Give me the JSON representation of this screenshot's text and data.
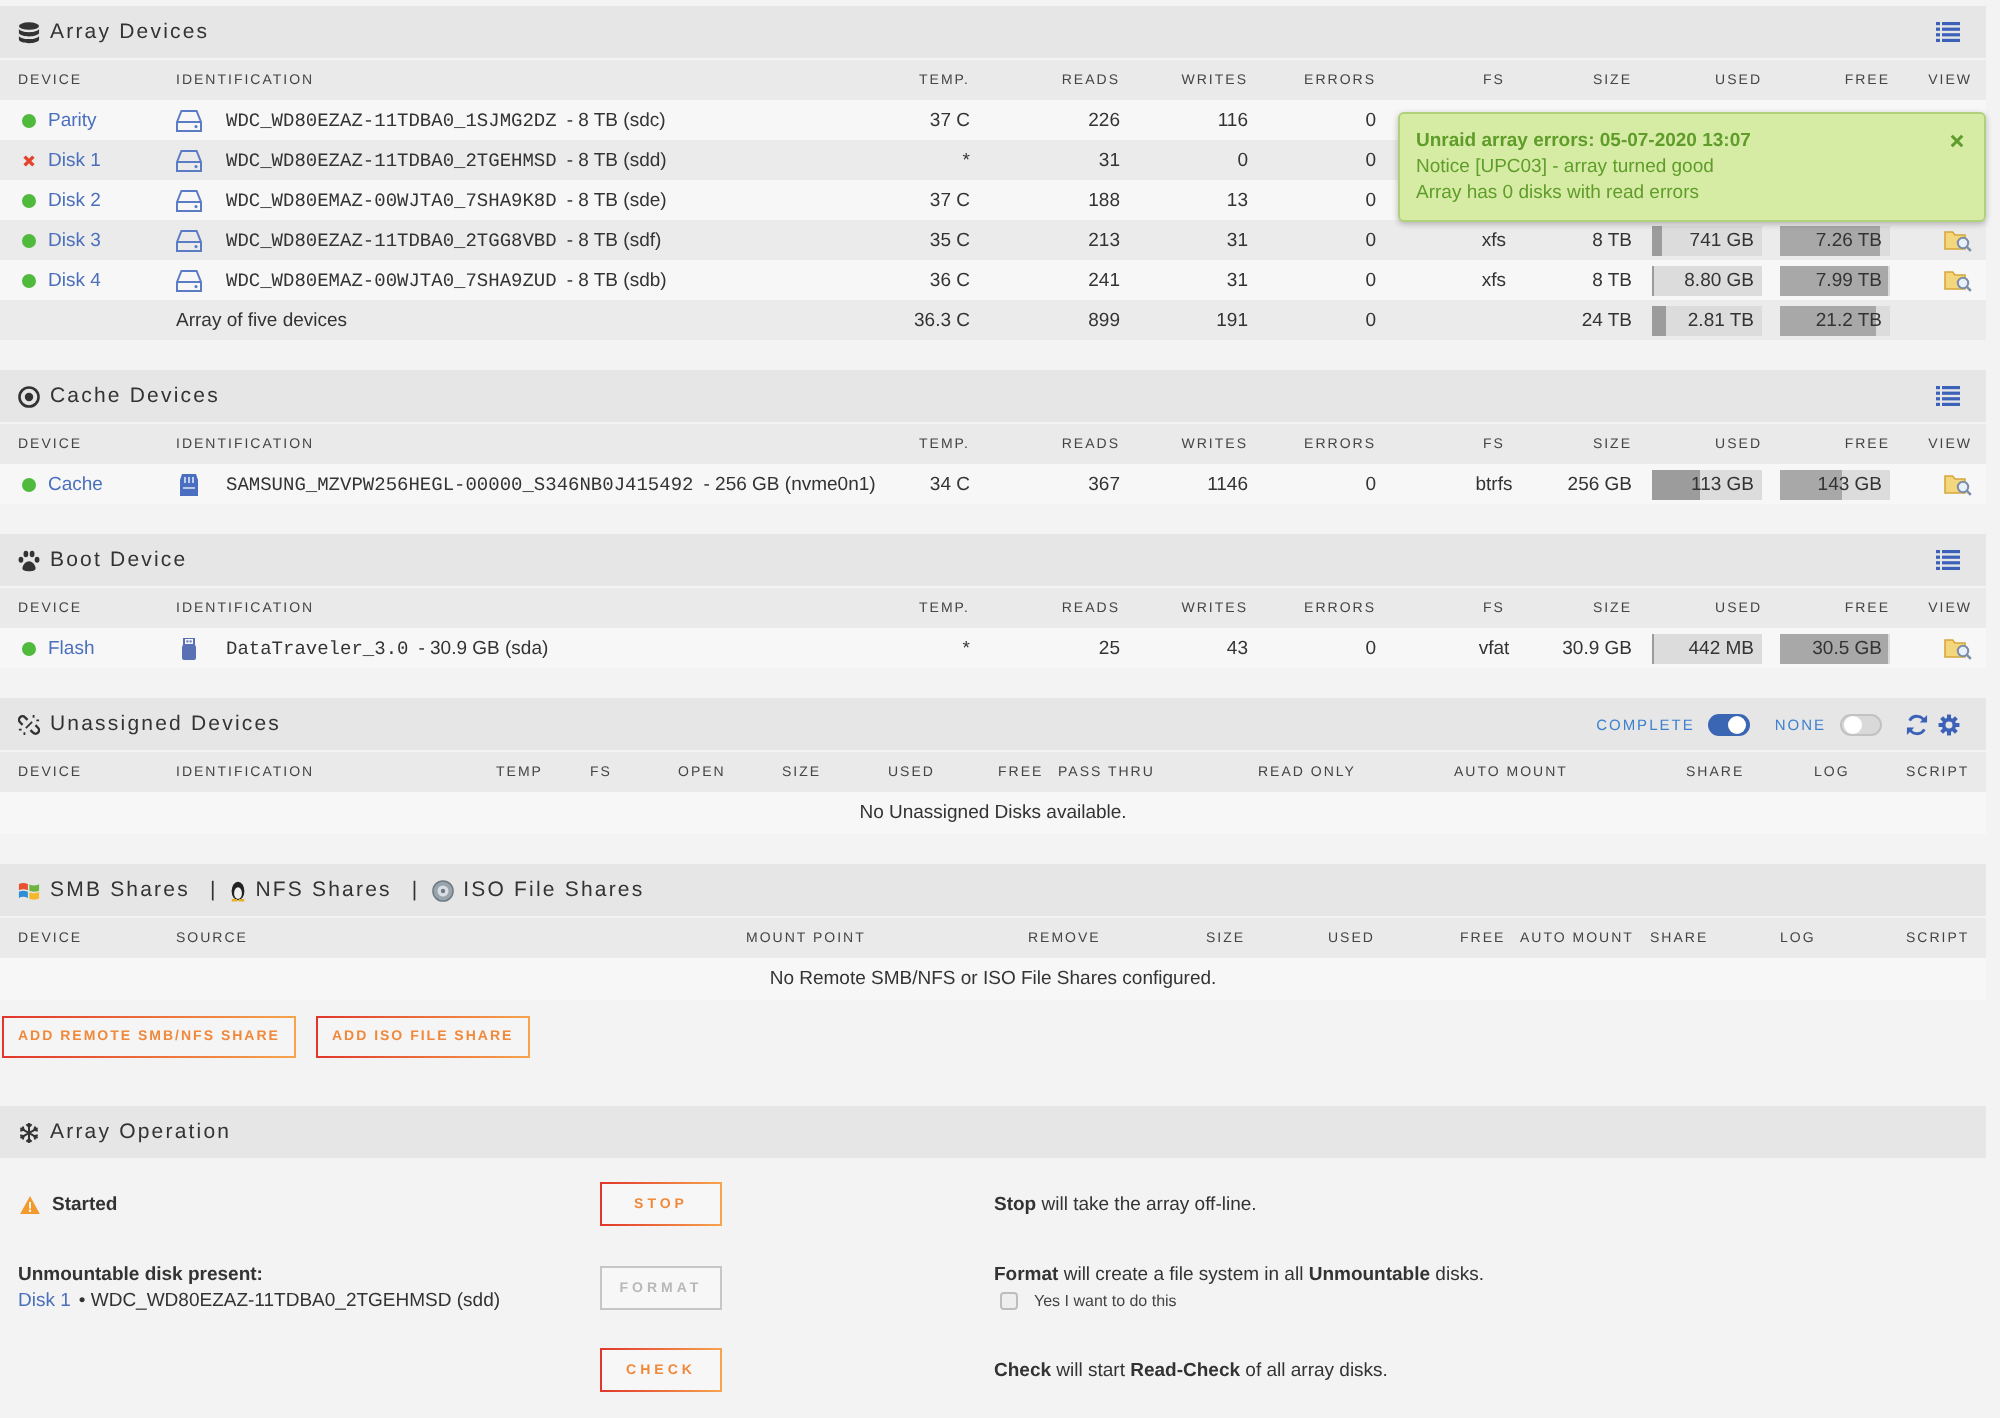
{
  "array_devices": {
    "title": "Array Devices",
    "columns": [
      "DEVICE",
      "IDENTIFICATION",
      "TEMP.",
      "READS",
      "WRITES",
      "ERRORS",
      "FS",
      "SIZE",
      "USED",
      "FREE",
      "VIEW"
    ],
    "rows": [
      {
        "device": "Parity",
        "failed": false,
        "identification": "WDC_WD80EZAZ-11TDBA0_1SJMG2DZ",
        "capacity": "- 8 TB (sdc)",
        "temp": "37 C",
        "reads": "226",
        "writes": "116",
        "errors": "0"
      },
      {
        "device": "Disk 1",
        "failed": true,
        "identification": "WDC_WD80EZAZ-11TDBA0_2TGEHMSD",
        "capacity": "- 8 TB (sdd)",
        "temp": "*",
        "reads": "31",
        "writes": "0",
        "errors": "0"
      },
      {
        "device": "Disk 2",
        "failed": false,
        "identification": "WDC_WD80EMAZ-00WJTA0_7SHA9K8D",
        "capacity": "- 8 TB (sde)",
        "temp": "37 C",
        "reads": "188",
        "writes": "13",
        "errors": "0"
      },
      {
        "device": "Disk 3",
        "failed": false,
        "identification": "WDC_WD80EZAZ-11TDBA0_2TGG8VBD",
        "capacity": "- 8 TB (sdf)",
        "temp": "35 C",
        "reads": "213",
        "writes": "31",
        "errors": "0",
        "fs": "xfs",
        "size": "8 TB",
        "used": {
          "text": "741 GB",
          "level": 0.09
        },
        "free": {
          "text": "7.26 TB",
          "level": 0.91
        },
        "view": true
      },
      {
        "device": "Disk 4",
        "failed": false,
        "identification": "WDC_WD80EMAZ-00WJTA0_7SHA9ZUD",
        "capacity": "- 8 TB (sdb)",
        "temp": "36 C",
        "reads": "241",
        "writes": "31",
        "errors": "0",
        "fs": "xfs",
        "size": "8 TB",
        "used": {
          "text": "8.80 GB",
          "level": 0.02
        },
        "free": {
          "text": "7.99 TB",
          "level": 0.98
        },
        "view": true
      }
    ],
    "summary": {
      "label": "Array of five devices",
      "temp": "36.3 C",
      "reads": "899",
      "writes": "191",
      "errors": "0",
      "size": "24 TB",
      "used": {
        "text": "2.81 TB",
        "level": 0.12
      },
      "free": {
        "text": "21.2 TB",
        "level": 0.88
      }
    }
  },
  "notification": {
    "title": "Unraid array errors: 05-07-2020 13:07",
    "lines": [
      "Notice [UPC03] - array turned good",
      "Array has 0 disks with read errors"
    ]
  },
  "cache_devices": {
    "title": "Cache Devices",
    "columns": [
      "DEVICE",
      "IDENTIFICATION",
      "TEMP.",
      "READS",
      "WRITES",
      "ERRORS",
      "FS",
      "SIZE",
      "USED",
      "FREE",
      "VIEW"
    ],
    "rows": [
      {
        "device": "Cache",
        "failed": false,
        "identification": "SAMSUNG_MZVPW256HEGL-00000_S346NB0J415492",
        "capacity": "- 256 GB (nvme0n1)",
        "temp": "34 C",
        "reads": "367",
        "writes": "1146",
        "errors": "0",
        "fs": "btrfs",
        "size": "256 GB",
        "used": {
          "text": "113 GB",
          "level": 0.44
        },
        "free": {
          "text": "143 GB",
          "level": 0.56
        },
        "view": true
      }
    ]
  },
  "boot_device": {
    "title": "Boot Device",
    "columns": [
      "DEVICE",
      "IDENTIFICATION",
      "TEMP.",
      "READS",
      "WRITES",
      "ERRORS",
      "FS",
      "SIZE",
      "USED",
      "FREE",
      "VIEW"
    ],
    "rows": [
      {
        "device": "Flash",
        "failed": false,
        "identification": "DataTraveler_3.0",
        "capacity": "- 30.9 GB (sda)",
        "temp": "*",
        "reads": "25",
        "writes": "43",
        "errors": "0",
        "fs": "vfat",
        "size": "30.9 GB",
        "used": {
          "text": "442 MB",
          "level": 0.02
        },
        "free": {
          "text": "30.5 GB",
          "level": 0.98
        },
        "view": true
      }
    ]
  },
  "unassigned_devices": {
    "title": "Unassigned Devices",
    "toggles": [
      {
        "label": "COMPLETE",
        "on": true
      },
      {
        "label": "NONE",
        "on": false
      }
    ],
    "columns": [
      "DEVICE",
      "IDENTIFICATION",
      "TEMP",
      "FS",
      "OPEN",
      "SIZE",
      "USED",
      "FREE",
      "PASS THRU",
      "READ ONLY",
      "AUTO MOUNT",
      "SHARE",
      "LOG",
      "SCRIPT"
    ],
    "message": "No Unassigned Disks available."
  },
  "remote_shares": {
    "title_parts": [
      {
        "label": "SMB Shares"
      },
      {
        "separator": "|",
        "label": "NFS Shares"
      },
      {
        "separator": "|",
        "label": "ISO File Shares"
      }
    ],
    "columns": [
      "DEVICE",
      "SOURCE",
      "MOUNT POINT",
      "REMOVE",
      "SIZE",
      "USED",
      "FREE",
      "AUTO MOUNT",
      "SHARE",
      "LOG",
      "SCRIPT"
    ],
    "message": "No Remote SMB/NFS or ISO File Shares configured.",
    "buttons": [
      "ADD REMOTE SMB/NFS SHARE",
      "ADD ISO FILE SHARE"
    ]
  },
  "array_operation": {
    "title": "Array Operation",
    "rows": [
      {
        "kind": "status",
        "label": "Started",
        "button": {
          "label": "STOP",
          "disabled": false
        },
        "description": "**Stop** will take the array off-line."
      },
      {
        "kind": "unmountable",
        "label": "Unmountable disk present:",
        "disk_link": "Disk 1",
        "disk_info": "• WDC_WD80EZAZ-11TDBA0_2TGEHMSD (sdd)",
        "button": {
          "label": "FORMAT",
          "disabled": true
        },
        "description": "**Format** will create a file system in all **Unmountable** disks.",
        "confirm": {
          "label": "Yes I want to do this",
          "checked": false
        }
      },
      {
        "kind": "plain",
        "button": {
          "label": "CHECK",
          "disabled": false
        },
        "description": "**Check** will start **Read-Check** of all array disks."
      }
    ]
  }
}
